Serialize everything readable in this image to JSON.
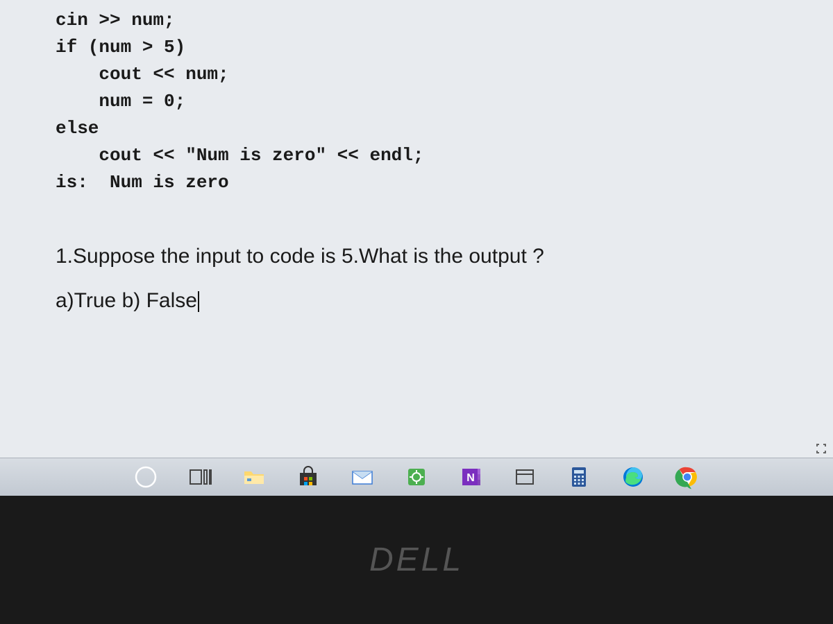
{
  "code": {
    "l1": "cin >> num;",
    "l2": "if (num > 5)",
    "l3": "    cout << num;",
    "l4": "    num = 0;",
    "l5": "else",
    "l6": "    cout << \"Num is zero\" << endl;",
    "l7": "is:  Num is zero"
  },
  "question": {
    "text": "1.Suppose the input to code is 5.What is the output ?",
    "answers": "a)True  b) False"
  },
  "logo": "DELL",
  "taskbar_icons": [
    "cortana-icon",
    "taskview-icon",
    "fileexplorer-icon",
    "store-icon",
    "mail-icon",
    "settings-icon",
    "onenote-icon",
    "window-icon",
    "calculator-icon",
    "edge-icon",
    "chrome-icon"
  ]
}
